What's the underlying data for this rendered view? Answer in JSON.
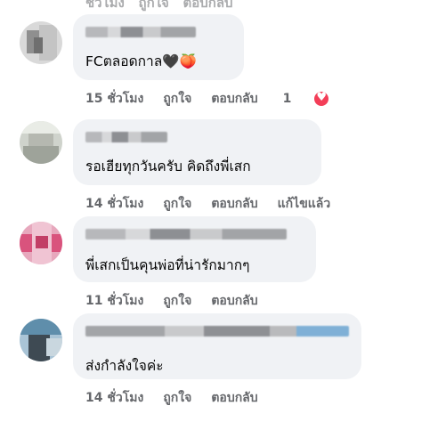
{
  "labels": {
    "like": "ถูกใจ",
    "reply": "ตอบกลับ",
    "edited": "แก้ไขแล้ว"
  },
  "comments": [
    {
      "text": "FCตลอดกาล🖤🍑",
      "time": "15 ชั่วโมง",
      "reaction_count": "1",
      "reaction_icon": "heart-icon"
    },
    {
      "text": "รอเฮียทุกวันครับ คิดถึงพี่เสก",
      "time": "14 ชั่วโมง"
    },
    {
      "text": "พี่เสกเป็นคุนพ่อที่น่ารักมากๆ",
      "time": "11 ชั่วโมง"
    },
    {
      "text": "ส่งกำลังใจค่ะ",
      "time": "14 ชั่วโมง"
    }
  ]
}
